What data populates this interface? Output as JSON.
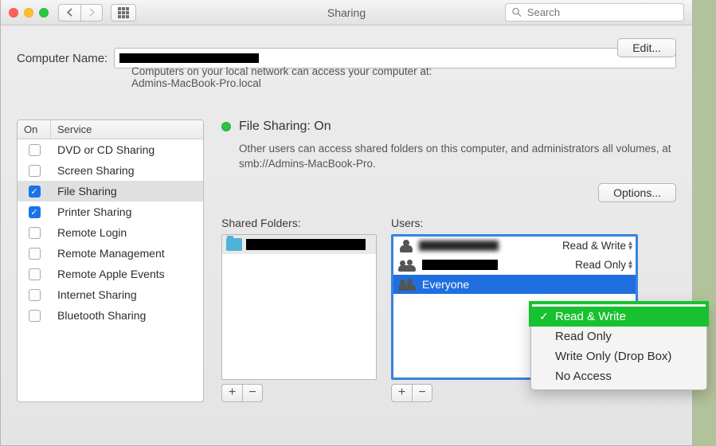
{
  "titlebar": {
    "title": "Sharing",
    "search_placeholder": "Search"
  },
  "computer_name": {
    "label": "Computer Name:",
    "value": "",
    "hint1": "Computers on your local network can access your computer at:",
    "hint2": "Admins-MacBook-Pro.local",
    "edit_label": "Edit..."
  },
  "services": {
    "col_on": "On",
    "col_service": "Service",
    "items": [
      {
        "label": "DVD or CD Sharing",
        "on": false,
        "sel": false
      },
      {
        "label": "Screen Sharing",
        "on": false,
        "sel": false
      },
      {
        "label": "File Sharing",
        "on": true,
        "sel": true
      },
      {
        "label": "Printer Sharing",
        "on": true,
        "sel": false
      },
      {
        "label": "Remote Login",
        "on": false,
        "sel": false
      },
      {
        "label": "Remote Management",
        "on": false,
        "sel": false
      },
      {
        "label": "Remote Apple Events",
        "on": false,
        "sel": false
      },
      {
        "label": "Internet Sharing",
        "on": false,
        "sel": false
      },
      {
        "label": "Bluetooth Sharing",
        "on": false,
        "sel": false
      }
    ]
  },
  "status": {
    "title": "File Sharing: On",
    "desc": "Other users can access shared folders on this computer, and administrators all volumes, at smb://Admins-MacBook-Pro.",
    "options_label": "Options..."
  },
  "shared": {
    "heading": "Shared Folders:"
  },
  "users": {
    "heading": "Users:",
    "rows": [
      {
        "name": "",
        "perm": "Read & Write",
        "sel": false
      },
      {
        "name": "",
        "perm": "Read Only",
        "sel": false
      },
      {
        "name": "Everyone",
        "perm": "",
        "sel": true
      }
    ]
  },
  "perm_menu": {
    "items": [
      {
        "label": "Read & Write",
        "sel": true
      },
      {
        "label": "Read Only",
        "sel": false
      },
      {
        "label": "Write Only (Drop Box)",
        "sel": false
      },
      {
        "label": "No Access",
        "sel": false
      }
    ]
  }
}
